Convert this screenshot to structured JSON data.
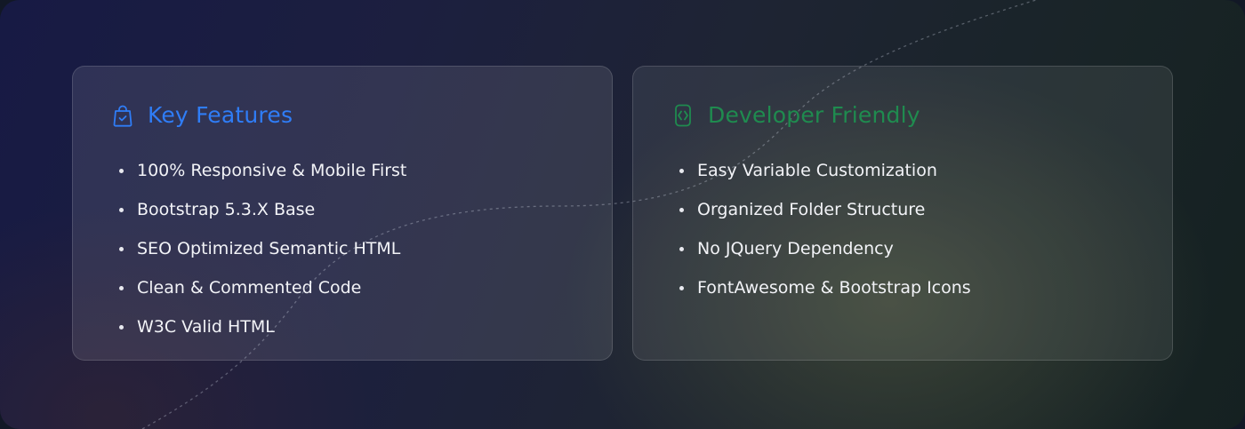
{
  "theme": {
    "key_features_color": "#2f7df7",
    "developer_friendly_color": "#1f8b4f"
  },
  "key_features": {
    "icon": "shopping-bag-check-icon",
    "title": "Key Features",
    "items": [
      "100% Responsive & Mobile First",
      "Bootstrap 5.3.X Base",
      "SEO Optimized Semantic HTML",
      "Clean & Commented Code",
      "W3C Valid HTML"
    ]
  },
  "developer_friendly": {
    "icon": "code-braces-icon",
    "title": "Developer Friendly",
    "items": [
      "Easy Variable Customization",
      "Organized Folder Structure",
      "No JQuery Dependency",
      "FontAwesome & Bootstrap Icons"
    ]
  }
}
